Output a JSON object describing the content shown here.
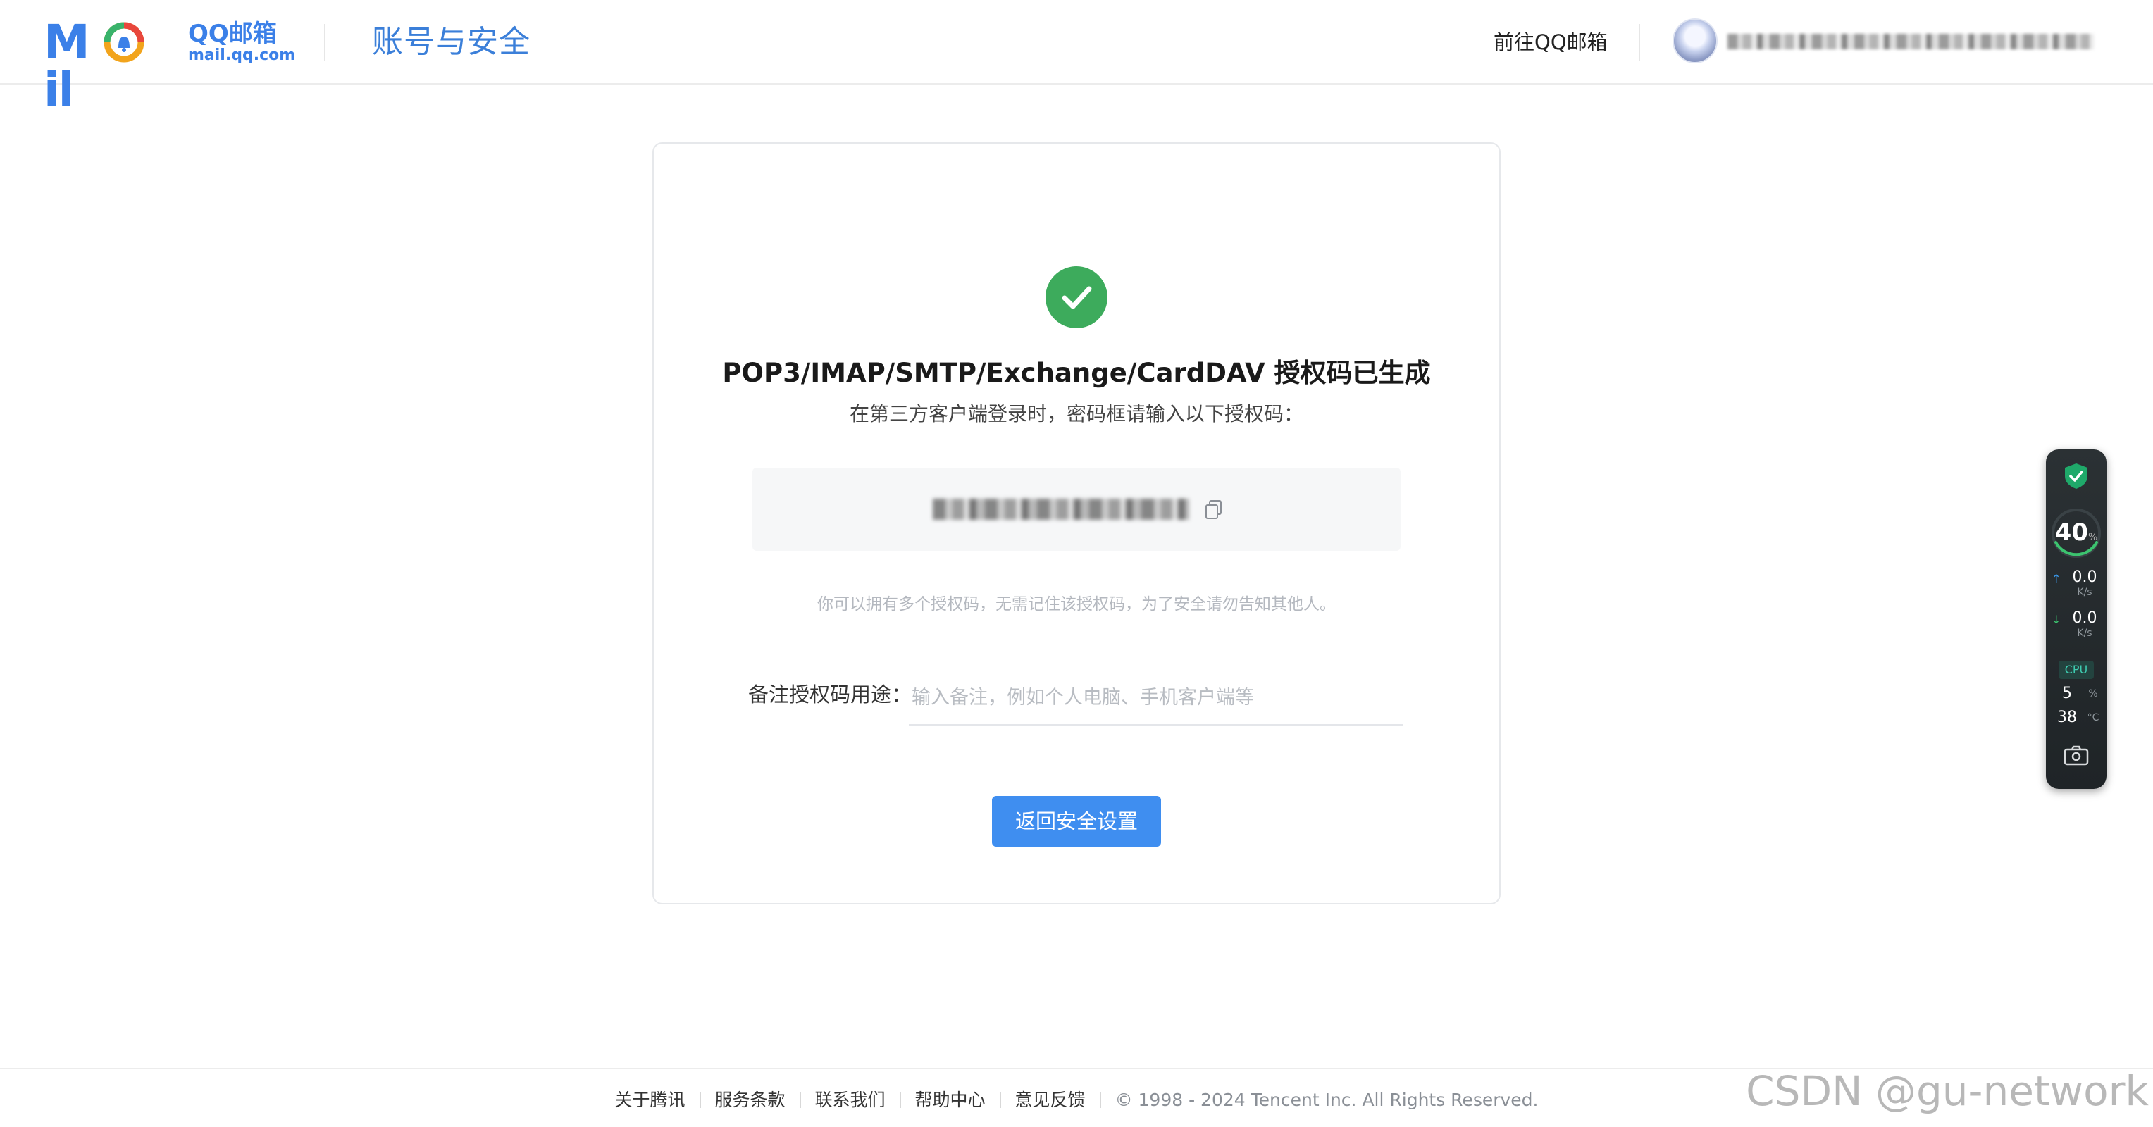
{
  "header": {
    "logo_word": "M  il",
    "logo_brand": "QQ邮箱",
    "logo_url": "mail.qq.com",
    "title": "账号与安全",
    "goto_link": "前往QQ邮箱"
  },
  "card": {
    "title": "POP3/IMAP/SMTP/Exchange/CardDAV 授权码已生成",
    "subtitle": "在第三方客户端登录时，密码框请输入以下授权码：",
    "hint": "你可以拥有多个授权码，无需记住该授权码，为了安全请勿告知其他人。",
    "note_label": "备注授权码用途：",
    "note_placeholder": "输入备注，例如个人电脑、手机客户端等",
    "note_value": "",
    "back_button": "返回安全设置"
  },
  "monitor": {
    "percent": "40",
    "percent_unit": "%",
    "upload": "0.0",
    "upload_unit": "K/s",
    "download": "0.0",
    "download_unit": "K/s",
    "cpu_label": "CPU",
    "cpu_usage": "5",
    "cpu_usage_unit": "%",
    "cpu_temp": "38",
    "cpu_temp_unit": "°C"
  },
  "footer": {
    "links": [
      "关于腾讯",
      "服务条款",
      "联系我们",
      "帮助中心",
      "意见反馈"
    ],
    "copyright": "© 1998 - 2024 Tencent Inc. All Rights Reserved."
  },
  "watermark": "CSDN @gu-network",
  "colors": {
    "brand_blue": "#3b80e8",
    "success_green": "#3dab5c",
    "button_blue": "#3f8ef0",
    "widget_teal": "#3ecbb0"
  },
  "icons": [
    "mail-logo-bell-icon",
    "success-check-icon",
    "copy-icon",
    "shield-check-icon",
    "upload-arrow-icon",
    "download-arrow-icon",
    "camera-icon"
  ]
}
